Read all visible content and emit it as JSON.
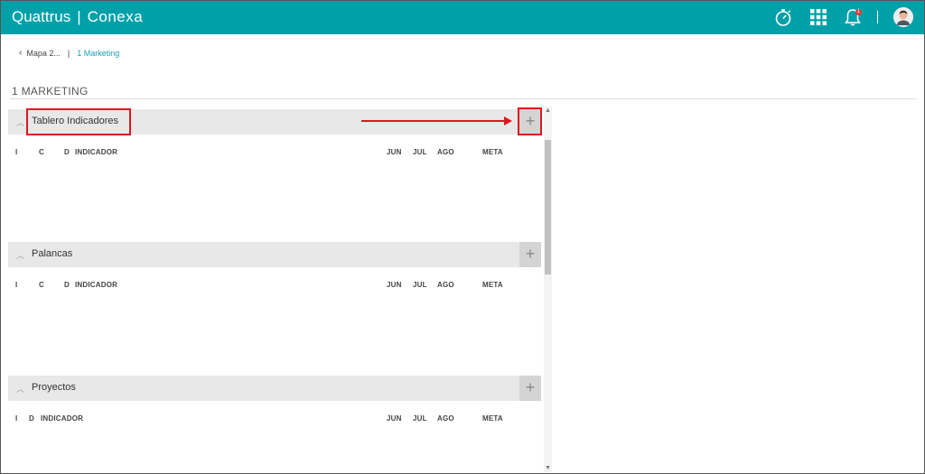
{
  "header": {
    "brand": "Quattrus",
    "separator": "|",
    "app_name": "Conexa",
    "notification_count": "1",
    "icons": [
      "stopwatch-icon",
      "apps-grid-icon",
      "bell-icon",
      "avatar"
    ]
  },
  "breadcrumb": {
    "back_label": "Mapa 2...",
    "divider": "|",
    "current": "1 Marketing"
  },
  "page_title": "1 MARKETING",
  "sections": [
    {
      "title": "Tablero Indicadores",
      "columns": [
        "I",
        "C",
        "D",
        "INDICADOR",
        "JUN",
        "JUL",
        "AGO",
        "META"
      ]
    },
    {
      "title": "Palancas",
      "columns": [
        "I",
        "C",
        "D",
        "INDICADOR",
        "JUN",
        "JUL",
        "AGO",
        "META"
      ]
    },
    {
      "title": "Proyectos",
      "columns": [
        "I",
        "D",
        "INDICADOR",
        "JUN",
        "JUL",
        "AGO",
        "META"
      ]
    }
  ],
  "colors": {
    "topbar": "#00a0a8",
    "highlight": "#e0161f",
    "breadcrumb_link": "#1a9fb0"
  }
}
